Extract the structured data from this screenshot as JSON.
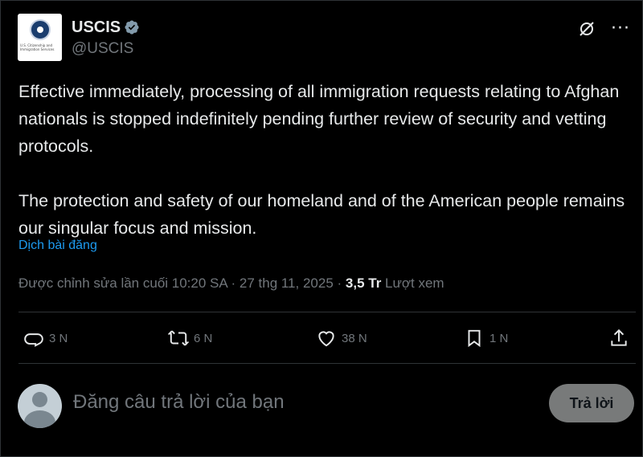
{
  "account": {
    "display_name": "USCIS",
    "handle": "@USCIS",
    "avatar_org_text": "U.S. Citizenship and Immigration Services",
    "verified_color": "#829aab"
  },
  "tweet": {
    "paragraphs": [
      "Effective immediately, processing of all immigration requests relating to Afghan nationals is stopped indefinitely pending further review of security and vetting protocols.",
      "The protection and safety of our homeland and of the American people remains our singular focus and mission."
    ],
    "translate_label": "Dịch bài đăng",
    "meta_prefix": "Được chỉnh sửa lần cuối 10:20 SA · 27 thg 11, 2025 · ",
    "views_count": "3,5 Tr",
    "views_label": " Lượt xem"
  },
  "actions": {
    "reply_count": "3 N",
    "repost_count": "6 N",
    "like_count": "38 N",
    "bookmark_count": "1 N"
  },
  "reply": {
    "placeholder": "Đăng câu trả lời của bạn",
    "button_label": "Trả lời"
  },
  "colors": {
    "background": "#000000",
    "text_primary": "#e7e9ea",
    "text_secondary": "#71767b",
    "link": "#1d9bf0",
    "divider": "#2f3336"
  },
  "icons": [
    "edited-icon",
    "more-icon",
    "reply-icon",
    "repost-icon",
    "like-icon",
    "bookmark-icon",
    "share-icon",
    "verified-badge-icon"
  ]
}
